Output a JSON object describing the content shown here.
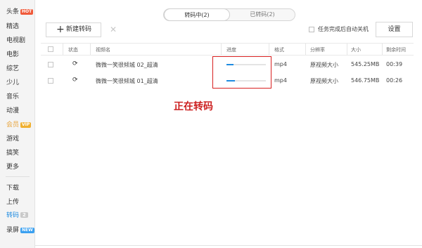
{
  "sidebar": {
    "items": [
      {
        "label": "头条",
        "badge": "HOT"
      },
      {
        "label": "精选"
      },
      {
        "label": "电视剧"
      },
      {
        "label": "电影"
      },
      {
        "label": "综艺"
      },
      {
        "label": "少儿"
      },
      {
        "label": "音乐"
      },
      {
        "label": "动漫"
      },
      {
        "label": "会员",
        "badge": "VIP"
      },
      {
        "label": "游戏"
      },
      {
        "label": "搞笑"
      },
      {
        "label": "更多"
      },
      {
        "label": "下载"
      },
      {
        "label": "上传"
      },
      {
        "label": "转码",
        "badge": "2"
      },
      {
        "label": "录屏",
        "badge": "NEW"
      }
    ]
  },
  "tabs": {
    "active": "转码中(2)",
    "done": "已转码(2)"
  },
  "toolbar": {
    "new_label": "新建转码",
    "plus": "+",
    "delete": "✕",
    "auto_shutdown": "任务完成后自动关机",
    "settings": "设置"
  },
  "table": {
    "headers": {
      "status": "状态",
      "name": "视频名",
      "progress": "进度",
      "format": "格式",
      "resolution": "分辨率",
      "size": "大小",
      "remaining": "剩余时间"
    },
    "rows": [
      {
        "name": "微微一笑很倾城 02_超清",
        "progress": 0.18,
        "format": "mp4",
        "resolution": "原视频大小",
        "size": "545.25MB",
        "remaining": "00:39"
      },
      {
        "name": "微微一笑很倾城 01_超清",
        "progress": 0.22,
        "format": "mp4",
        "resolution": "原视频大小",
        "size": "546.75MB",
        "remaining": "00:26"
      }
    ]
  },
  "annotation": "正在转码",
  "colors": {
    "accent": "#1e8be0",
    "annotation": "#cc1f1f",
    "hot": "#f05a3a",
    "vip": "#f0b030",
    "new": "#3aa0f0"
  }
}
